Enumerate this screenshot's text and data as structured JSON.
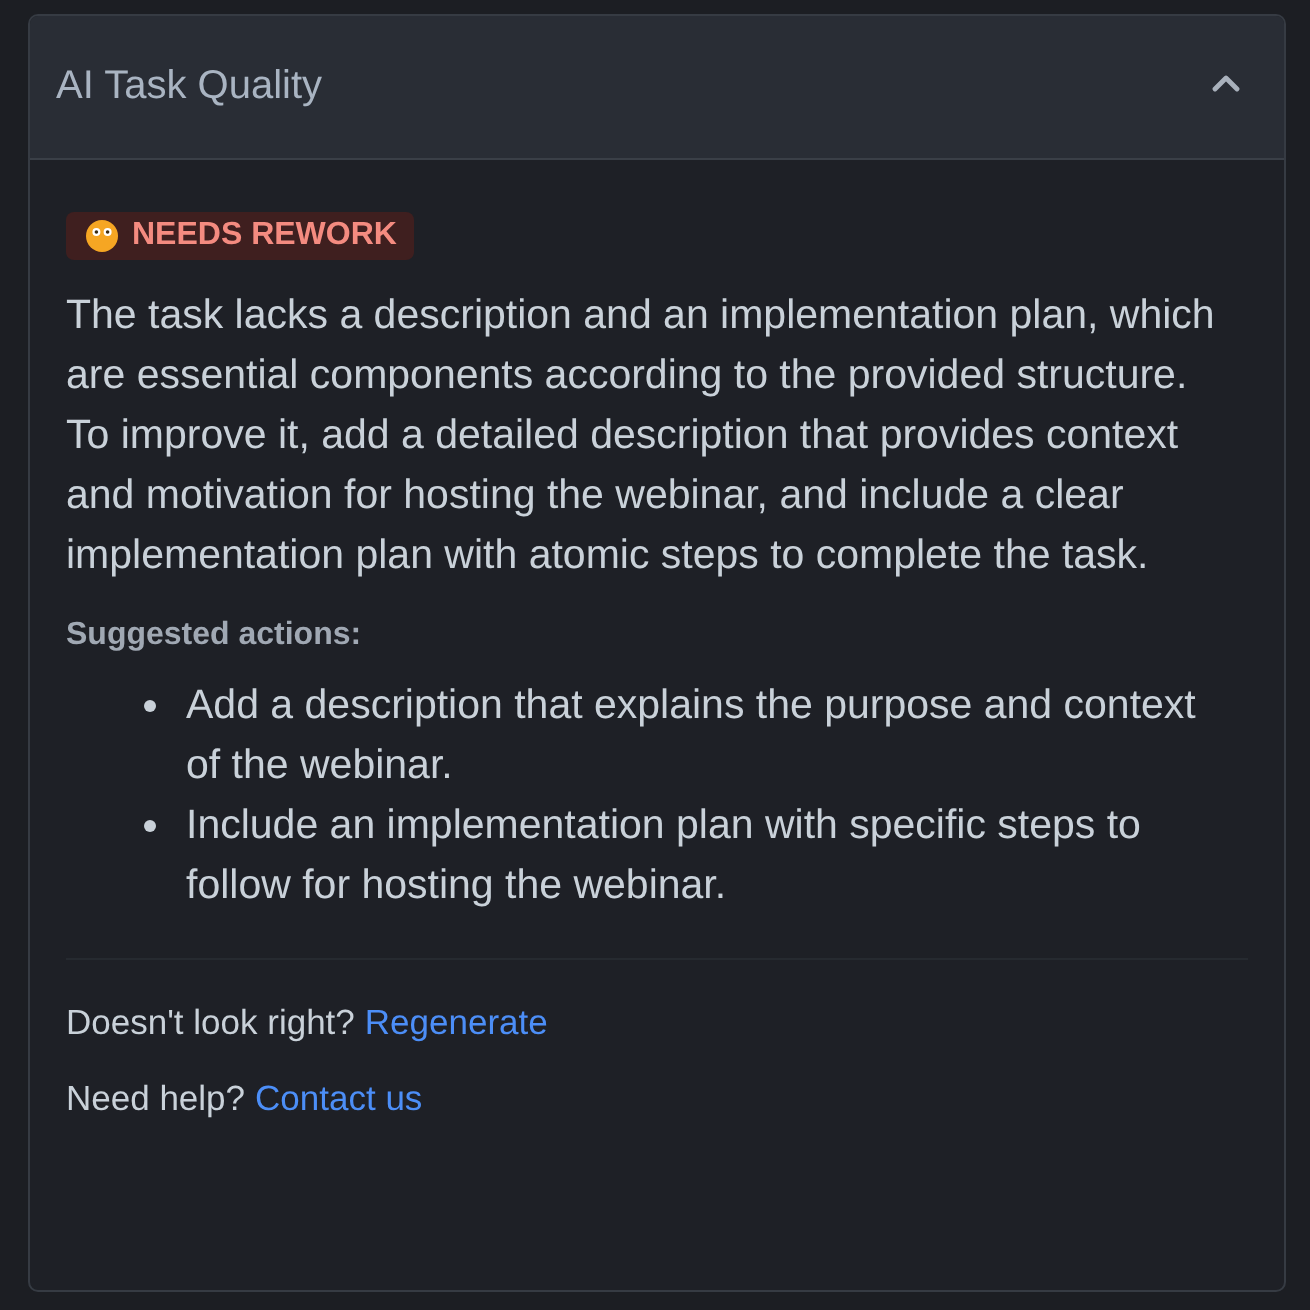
{
  "panel": {
    "title": "AI Task Quality",
    "expanded": true
  },
  "status_badge": {
    "label": "NEEDS REWORK",
    "kind": "needs_rework"
  },
  "summary": "The task lacks a description and an implementation plan, which are essential components according to the provided structure. To improve it, add a detailed description that provides context and motivation for hosting the webinar, and include a clear implementation plan with atomic steps to complete the task.",
  "suggested_actions": {
    "heading": "Suggested actions:",
    "items": [
      "Add a description that explains the purpose and context of the webinar.",
      "Include an implementation plan with specific steps to follow for hosting the webinar."
    ]
  },
  "footer_links": [
    {
      "prompt": "Doesn't look right?",
      "link": "Regenerate"
    },
    {
      "prompt": "Need help?",
      "link": "Contact us"
    }
  ]
}
